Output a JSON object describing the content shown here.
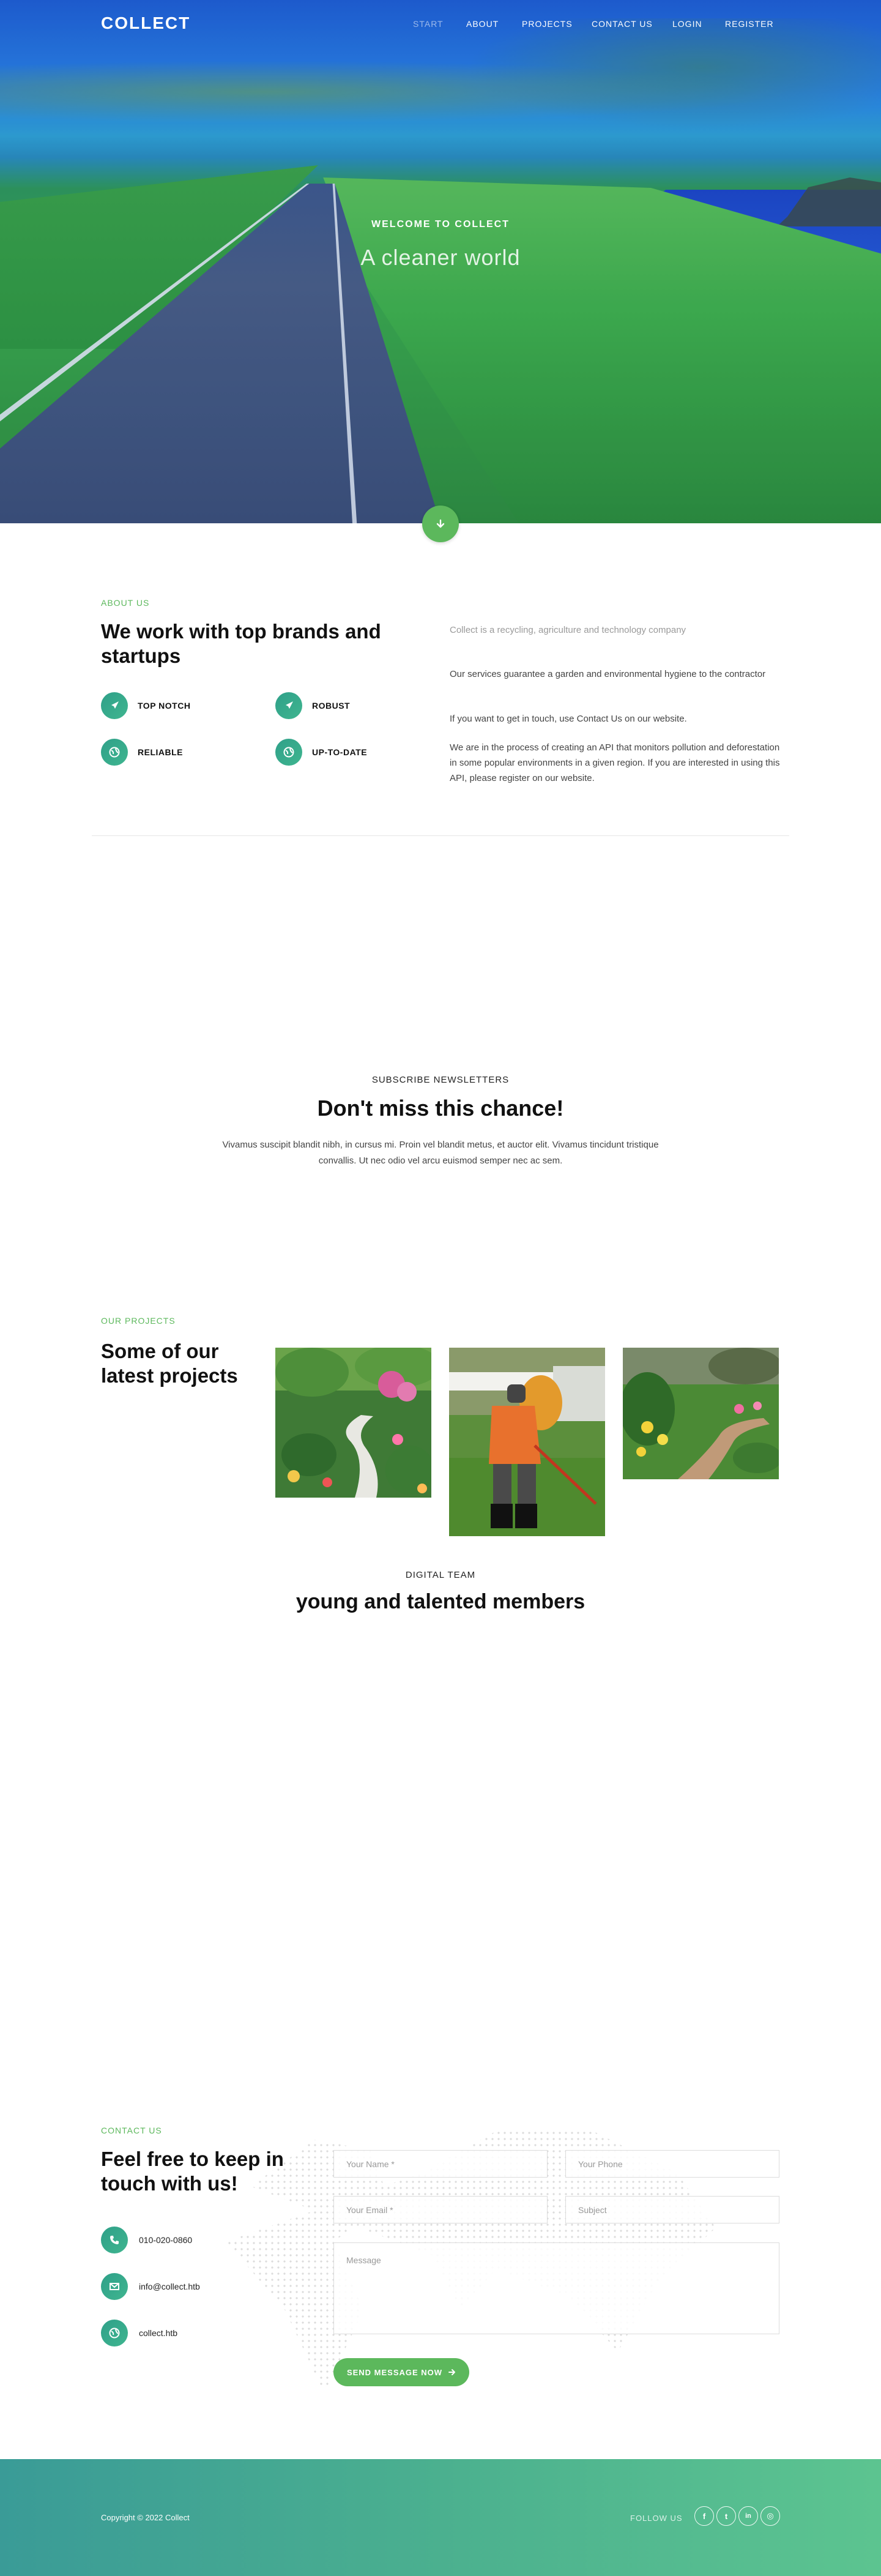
{
  "brand": "COLLECT",
  "nav": [
    {
      "label": "START",
      "active": true
    },
    {
      "label": "ABOUT"
    },
    {
      "label": "PROJECTS"
    },
    {
      "label": "CONTACT US"
    },
    {
      "label": "LOGIN"
    },
    {
      "label": "REGISTER"
    }
  ],
  "hero": {
    "kicker": "WELCOME TO COLLECT",
    "title": "A cleaner world",
    "scroll_icon": "arrow-down-icon"
  },
  "about": {
    "kicker": "ABOUT US",
    "title": "We work with top brands and startups",
    "features": [
      {
        "label": "TOP NOTCH",
        "icon": "rocket-icon"
      },
      {
        "label": "ROBUST",
        "icon": "rocket-icon"
      },
      {
        "label": "RELIABLE",
        "icon": "globe-icon"
      },
      {
        "label": "UP-TO-DATE",
        "icon": "globe-icon"
      }
    ],
    "lead": "Collect is a recycling, agriculture and technology company",
    "paragraphs": [
      "Our services guarantee a garden and environmental hygiene to the contractor",
      "If you want to get in touch, use Contact Us on our website.",
      "We are in the process of creating an API that monitors pollution and deforestation in some popular environments in a given region. If you are interested in using this API, please register on our website."
    ]
  },
  "subscribe": {
    "kicker": "SUBSCRIBE NEWSLETTERS",
    "title": "Don't miss this chance!",
    "text": "Vivamus suscipit blandit nibh, in cursus mi. Proin vel blandit metus, et auctor elit. Vivamus tincidunt tristique convallis. Ut nec odio vel arcu euismod semper nec ac sem."
  },
  "projects": {
    "kicker": "OUR PROJECTS",
    "title": "Some of our latest projects"
  },
  "team": {
    "kicker": "DIGITAL TEAM",
    "title": "young and talented members"
  },
  "contact": {
    "kicker": "CONTACT US",
    "title": "Feel free to keep in touch with us!",
    "phone": "010-020-0860",
    "email": "info@collect.htb",
    "website": "collect.htb",
    "form": {
      "name_placeholder": "Your Name *",
      "phone_placeholder": "Your Phone",
      "email_placeholder": "Your Email *",
      "subject_placeholder": "Subject",
      "message_placeholder": "Message",
      "submit_label": "SEND MESSAGE NOW"
    }
  },
  "footer": {
    "copyright": "Copyright © 2022 Collect",
    "follow_label": "FOLLOW US",
    "social": [
      {
        "icon": "facebook-icon",
        "glyph": "f"
      },
      {
        "icon": "twitter-icon",
        "glyph": "t"
      },
      {
        "icon": "linkedin-icon",
        "glyph": "in"
      },
      {
        "icon": "instagram-icon",
        "glyph": "◎"
      }
    ]
  },
  "colors": {
    "accent": "#5cb85c",
    "icon_teal": "#2fa089",
    "footer_start": "#3a9b97",
    "footer_end": "#5cc490"
  }
}
